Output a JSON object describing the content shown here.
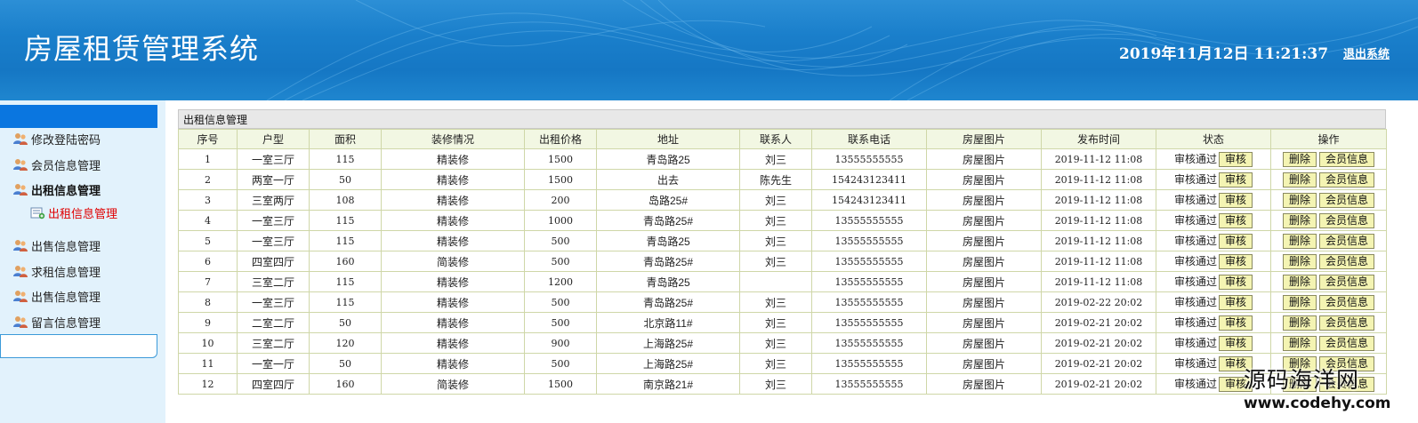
{
  "header": {
    "title": "房屋租赁管理系统",
    "clock": "2019年11月12日 11:21:37",
    "logout_label": "退出系统",
    "colors": {
      "banner": "#1a7fcb",
      "text": "#ffffff"
    }
  },
  "sidebar": {
    "items": [
      {
        "label": "修改登陆密码",
        "icon": "users-icon"
      },
      {
        "label": "会员信息管理",
        "icon": "users-icon"
      },
      {
        "label": "出租信息管理",
        "icon": "users-icon",
        "active": true
      },
      {
        "label": "出售信息管理",
        "icon": "users-icon"
      },
      {
        "label": "求租信息管理",
        "icon": "users-icon"
      },
      {
        "label": "出售信息管理",
        "icon": "users-icon"
      },
      {
        "label": "留言信息管理",
        "icon": "users-icon"
      }
    ],
    "subitem": {
      "label": "出租信息管理",
      "icon": "list-add-icon",
      "color": "#e00000"
    }
  },
  "main": {
    "panel_title": "出租信息管理",
    "columns": [
      "序号",
      "户型",
      "面积",
      "装修情况",
      "出租价格",
      "地址",
      "联系人",
      "联系电话",
      "房屋图片",
      "发布时间",
      "状态",
      "操作"
    ],
    "status_label": "审核通过",
    "review_button": "审核",
    "delete_button": "删除",
    "member_button": "会员信息",
    "rows": [
      {
        "id": "1",
        "type": "一室三厅",
        "area": "115",
        "decor": "精装修",
        "price": "1500",
        "address": "青岛路25",
        "contact": "刘三",
        "phone": "13555555555",
        "photo": "房屋图片",
        "time": "2019-11-12 11:08"
      },
      {
        "id": "2",
        "type": "两室一厅",
        "area": "50",
        "decor": "精装修",
        "price": "1500",
        "address": "出去",
        "contact": "陈先生",
        "phone": "154243123411",
        "photo": "房屋图片",
        "time": "2019-11-12 11:08"
      },
      {
        "id": "3",
        "type": "三室两厅",
        "area": "108",
        "decor": "精装修",
        "price": "200",
        "address": "岛路25#",
        "contact": "刘三",
        "phone": "154243123411",
        "photo": "房屋图片",
        "time": "2019-11-12 11:08"
      },
      {
        "id": "4",
        "type": "一室三厅",
        "area": "115",
        "decor": "精装修",
        "price": "1000",
        "address": "青岛路25#",
        "contact": "刘三",
        "phone": "13555555555",
        "photo": "房屋图片",
        "time": "2019-11-12 11:08"
      },
      {
        "id": "5",
        "type": "一室三厅",
        "area": "115",
        "decor": "精装修",
        "price": "500",
        "address": "青岛路25",
        "contact": "刘三",
        "phone": "13555555555",
        "photo": "房屋图片",
        "time": "2019-11-12 11:08"
      },
      {
        "id": "6",
        "type": "四室四厅",
        "area": "160",
        "decor": "简装修",
        "price": "500",
        "address": "青岛路25#",
        "contact": "刘三",
        "phone": "13555555555",
        "photo": "房屋图片",
        "time": "2019-11-12 11:08"
      },
      {
        "id": "7",
        "type": "三室二厅",
        "area": "115",
        "decor": "精装修",
        "price": "1200",
        "address": "青岛路25",
        "contact": "",
        "phone": "13555555555",
        "photo": "房屋图片",
        "time": "2019-11-12 11:08"
      },
      {
        "id": "8",
        "type": "一室三厅",
        "area": "115",
        "decor": "精装修",
        "price": "500",
        "address": "青岛路25#",
        "contact": "刘三",
        "phone": "13555555555",
        "photo": "房屋图片",
        "time": "2019-02-22 20:02"
      },
      {
        "id": "9",
        "type": "二室二厅",
        "area": "50",
        "decor": "精装修",
        "price": "500",
        "address": "北京路11#",
        "contact": "刘三",
        "phone": "13555555555",
        "photo": "房屋图片",
        "time": "2019-02-21 20:02"
      },
      {
        "id": "10",
        "type": "三室二厅",
        "area": "120",
        "decor": "精装修",
        "price": "900",
        "address": "上海路25#",
        "contact": "刘三",
        "phone": "13555555555",
        "photo": "房屋图片",
        "time": "2019-02-21 20:02"
      },
      {
        "id": "11",
        "type": "一室一厅",
        "area": "50",
        "decor": "精装修",
        "price": "500",
        "address": "上海路25#",
        "contact": "刘三",
        "phone": "13555555555",
        "photo": "房屋图片",
        "time": "2019-02-21 20:02"
      },
      {
        "id": "12",
        "type": "四室四厅",
        "area": "160",
        "decor": "简装修",
        "price": "1500",
        "address": "南京路21#",
        "contact": "刘三",
        "phone": "13555555555",
        "photo": "房屋图片",
        "time": "2019-02-21 20:02"
      }
    ]
  },
  "watermark": {
    "cn": "源码海洋网",
    "url": "www.codehy.com"
  }
}
